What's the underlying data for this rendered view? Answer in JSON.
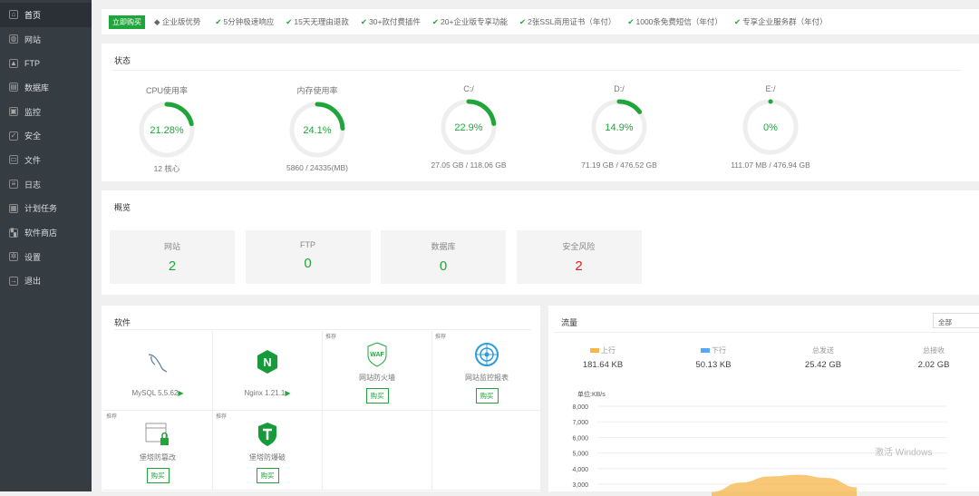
{
  "sidebar": {
    "items": [
      {
        "label": "首页",
        "icon": "home-icon"
      },
      {
        "label": "网站",
        "icon": "globe-icon"
      },
      {
        "label": "FTP",
        "icon": "ftp-icon"
      },
      {
        "label": "数据库",
        "icon": "database-icon"
      },
      {
        "label": "监控",
        "icon": "monitor-icon"
      },
      {
        "label": "安全",
        "icon": "shield-icon"
      },
      {
        "label": "文件",
        "icon": "folder-icon"
      },
      {
        "label": "日志",
        "icon": "log-icon"
      },
      {
        "label": "计划任务",
        "icon": "calendar-icon"
      },
      {
        "label": "软件商店",
        "icon": "grid-icon"
      },
      {
        "label": "设置",
        "icon": "gear-icon"
      },
      {
        "label": "退出",
        "icon": "logout-icon"
      }
    ]
  },
  "topbar": {
    "buy": "立即购买",
    "advantage": "企业版优势",
    "features": [
      "5分钟极速响应",
      "15天无理由退款",
      "30+款付费插件",
      "20+企业版专享功能",
      "2张SSL商用证书（年付）",
      "1000条免费短信（年付）",
      "专享企业服务群（年付）"
    ]
  },
  "status": {
    "title": "状态",
    "gauges": [
      {
        "label": "CPU使用率",
        "value": "21.28%",
        "pct": 21.28,
        "sub": "12 核心"
      },
      {
        "label": "内存使用率",
        "value": "24.1%",
        "pct": 24.1,
        "sub": "5860 / 24335(MB)"
      },
      {
        "label": "C:/",
        "value": "22.9%",
        "pct": 22.9,
        "sub": "27.05 GB / 118.06 GB"
      },
      {
        "label": "D:/",
        "value": "14.9%",
        "pct": 14.9,
        "sub": "71.19 GB / 476.52 GB"
      },
      {
        "label": "E:/",
        "value": "0%",
        "pct": 0,
        "sub": "111.07 MB / 476.94 GB"
      }
    ]
  },
  "overview": {
    "title": "概览",
    "cards": [
      {
        "label": "网站",
        "value": "2",
        "color": "#20a53a"
      },
      {
        "label": "FTP",
        "value": "0",
        "color": "#20a53a"
      },
      {
        "label": "数据库",
        "value": "0",
        "color": "#20a53a"
      },
      {
        "label": "安全风险",
        "value": "2",
        "color": "#e02020"
      }
    ]
  },
  "software": {
    "title": "软件",
    "tag": "推荐",
    "buy": "购买",
    "items": [
      {
        "name": "MySQL 5.5.62",
        "play": "▶"
      },
      {
        "name": "Nginx 1.21.1",
        "play": "▶"
      },
      {
        "name": "网站防火墙"
      },
      {
        "name": "网站监控报表"
      },
      {
        "name": "堡塔防篡改"
      },
      {
        "name": "堡塔防爆破"
      }
    ]
  },
  "traffic": {
    "title": "流量",
    "select": "全部",
    "stats": [
      {
        "label": "上行",
        "value": "181.64 KB",
        "color": "#f7b54a"
      },
      {
        "label": "下行",
        "value": "50.13 KB",
        "color": "#52a9ff"
      },
      {
        "label": "总发送",
        "value": "25.42 GB"
      },
      {
        "label": "总接收",
        "value": "2.02 GB"
      }
    ]
  },
  "chart_data": {
    "type": "area",
    "ylabel": "单位:KB/s",
    "yticks": [
      "8,000",
      "7,000",
      "6,000",
      "5,000",
      "4,000",
      "3,000"
    ],
    "ylim": [
      3000,
      8000
    ],
    "series": [
      {
        "name": "上行",
        "color": "#f7b54a",
        "values": [
          2500,
          3100,
          3500,
          3600,
          3400,
          2800
        ]
      }
    ]
  }
}
